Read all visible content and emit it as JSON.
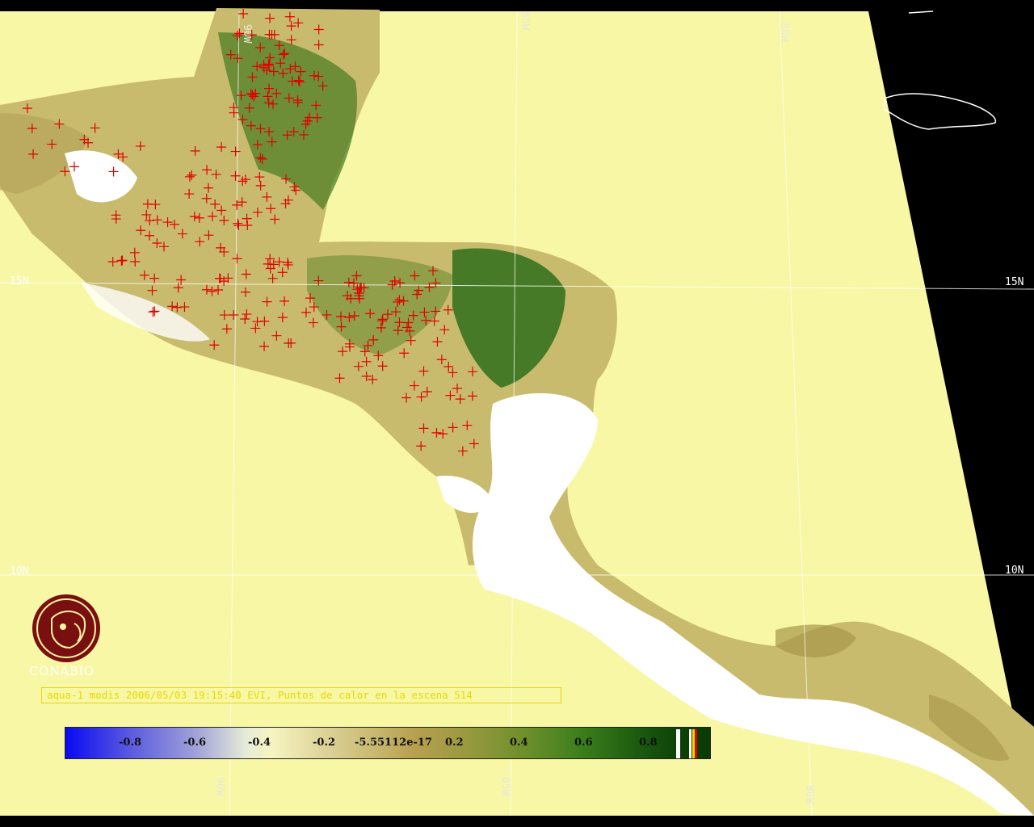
{
  "map": {
    "lat_labels": [
      "15N",
      "10N",
      "15N",
      "10N"
    ],
    "lon_labels": [
      "90W",
      "85W",
      "80W",
      "90W",
      "85W",
      "80W"
    ],
    "colors": {
      "ocean": "#f7f7a6",
      "no_data": "#000000",
      "cloud": "#ffffff",
      "vegetation": "#2f6e1a",
      "dry_land": "#c4b46c",
      "hotspot": "#e00000",
      "grid": "#ffffff"
    }
  },
  "logo": {
    "text": "CONABIO",
    "icon": "conabio-logo-icon"
  },
  "caption": {
    "text": "aqua-1 modis 2006/05/03 19:15:40 EVI, Puntos de calor en la escena 514"
  },
  "colorbar": {
    "ticks": [
      "-0.8",
      "-0.6",
      "-0.4",
      "-0.2",
      "-5.55112e-17",
      "0.2",
      "0.4",
      "0.6",
      "0.8"
    ]
  }
}
